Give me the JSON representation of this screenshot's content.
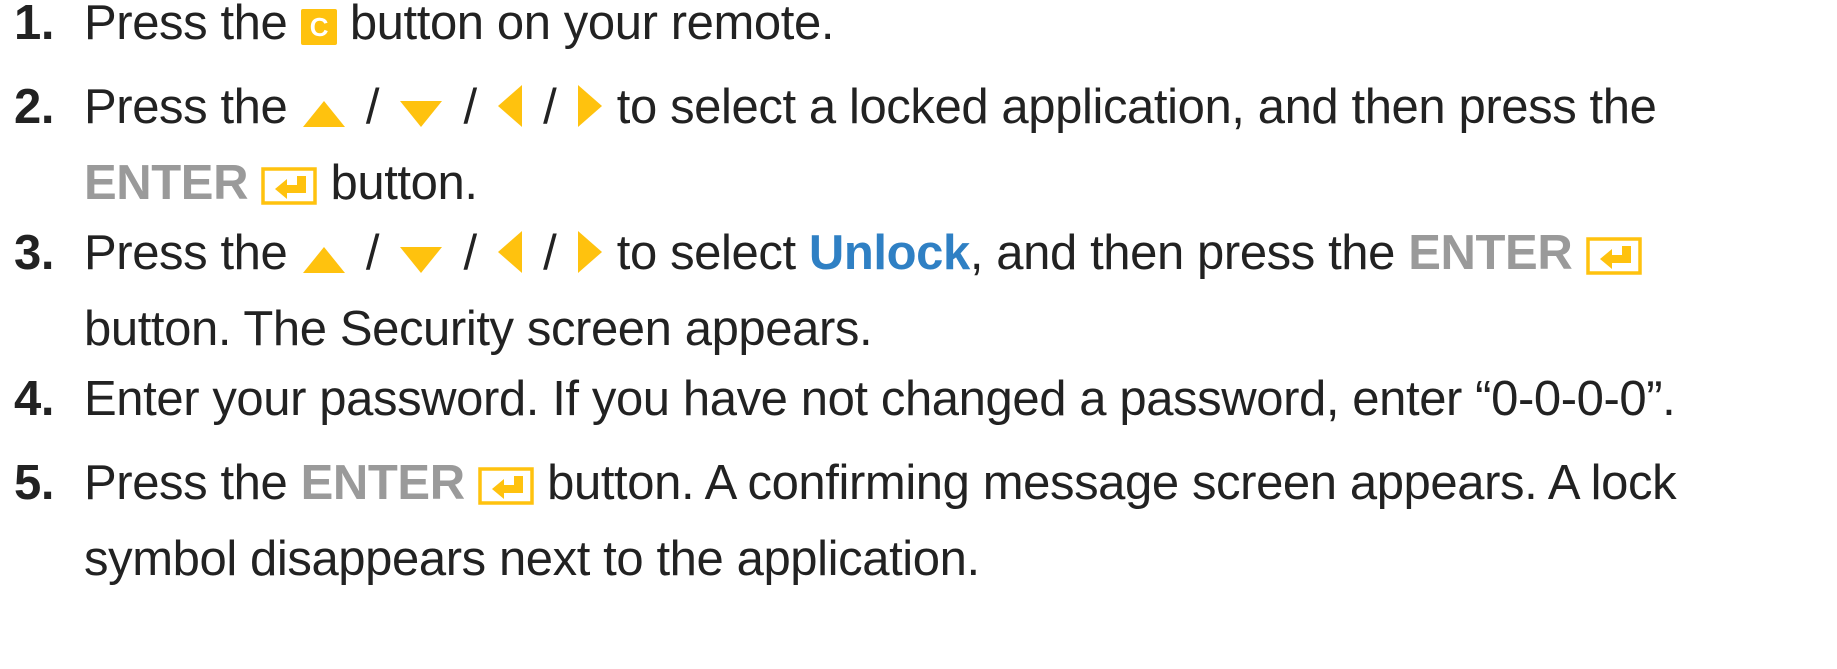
{
  "colors": {
    "accent_yellow": "#ffc20e",
    "enter_gray": "#9a9a9a",
    "unlock_blue": "#2f80c4",
    "text": "#222222"
  },
  "steps": [
    {
      "number": "1.",
      "press_the": "Press the",
      "c_key": "C",
      "after": "button on your remote."
    },
    {
      "number": "2.",
      "press_the": "Press the",
      "slash": "/",
      "after_arrows": "to select a locked application, and then press the",
      "enter": "ENTER",
      "after_enter": "button."
    },
    {
      "number": "3.",
      "press_the": "Press the",
      "slash": "/",
      "to_select": "to select",
      "unlock": "Unlock",
      "after_unlock": ", and then press the",
      "enter": "ENTER",
      "line2": "button. The Security screen appears."
    },
    {
      "number": "4.",
      "text": "Enter your password. If you have not changed a password, enter “0-0-0-0”."
    },
    {
      "number": "5.",
      "press_the": "Press the",
      "enter": "ENTER",
      "after_enter": "button. A confirming message screen appears. A lock",
      "line2": "symbol disappears next to the application."
    }
  ],
  "icons": {
    "c_button": "c-key-icon",
    "up": "up-arrow-icon",
    "down": "down-arrow-icon",
    "left": "left-arrow-icon",
    "right": "right-arrow-icon",
    "enter": "enter-key-icon"
  }
}
